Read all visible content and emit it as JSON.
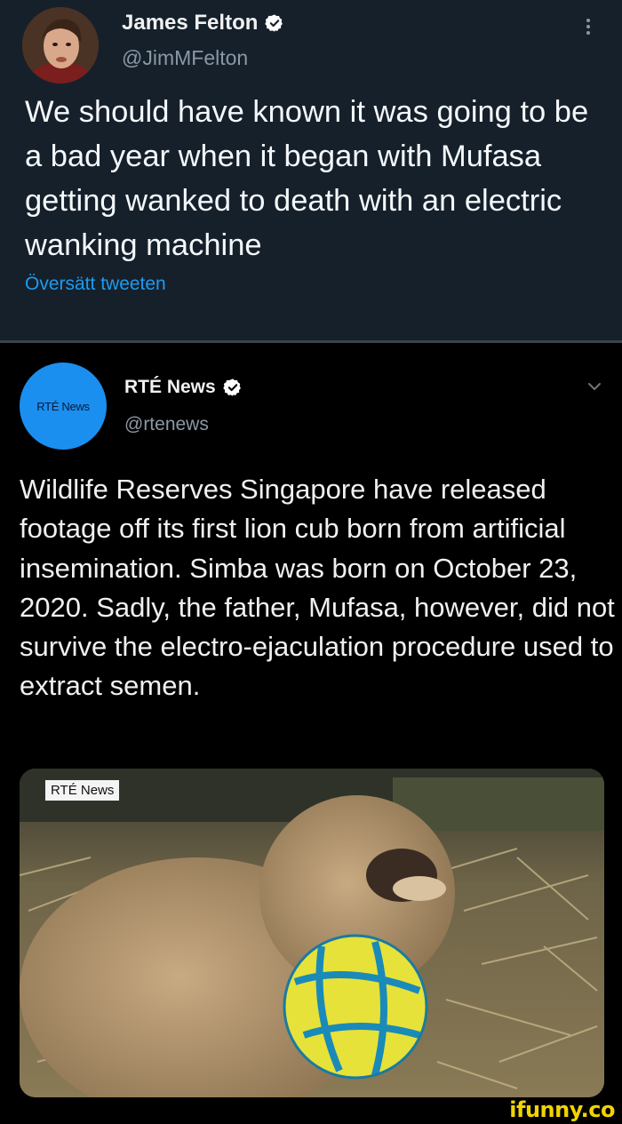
{
  "tweet": {
    "author_name": "James Felton",
    "author_handle": "@JimMFelton",
    "text": "We should have known it was going to be a bad year when it began with Mufasa getting wanked to death with an electric wanking machine",
    "translate_label": "Översätt tweeten"
  },
  "quoted_tweet": {
    "author_name": "RTÉ News",
    "author_handle": "@rtenews",
    "avatar_logo": "RTÉ News",
    "text": "Wildlife Reserves Singapore have released footage off its first lion cub born from artificial insemination. Simba was born on October 23, 2020. Sadly, the father, Mufasa, however, did not survive the electro-ejaculation procedure used to extract semen.",
    "media_tag": "RTÉ News"
  },
  "watermark": "ifunny.co",
  "colors": {
    "top_bg": "#15202b",
    "quoted_bg": "#000000",
    "link_blue": "#1d9bf0",
    "avatar_blue": "#1b8ff0",
    "watermark_yellow": "#f2d400"
  },
  "icons": [
    "verified-badge-icon",
    "more-options-icon",
    "chevron-down-icon"
  ]
}
